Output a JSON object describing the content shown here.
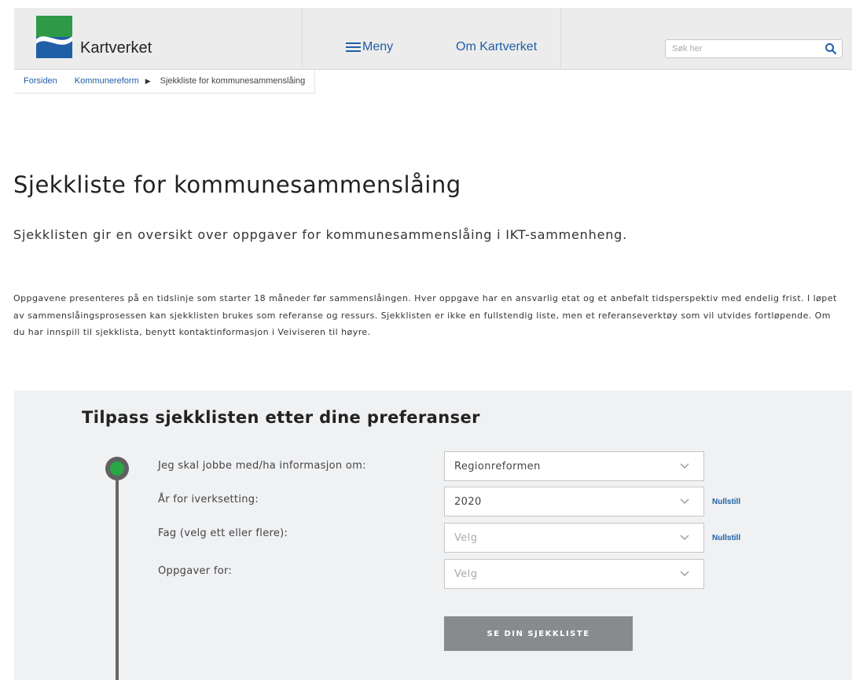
{
  "header": {
    "brand": "Kartverket",
    "menu_label": "Meny",
    "about_label": "Om Kartverket",
    "search_placeholder": "Søk her"
  },
  "breadcrumb": {
    "items": [
      "Forsiden",
      "Kommunereform"
    ],
    "current": "Sjekkliste for kommunesammenslåing"
  },
  "page": {
    "title": "Sjekkliste for kommunesammenslåing",
    "lead": "Sjekklisten gir en oversikt over oppgaver for kommunesammenslåing i IKT-sammenheng.",
    "body": "Oppgavene presenteres på en tidslinje som starter 18 måneder før sammenslåingen. Hver oppgave har en ansvarlig etat og et anbefalt tidsperspektiv med endelig frist. I løpet av sammenslåingsprosessen kan sjekklisten brukes som referanse og ressurs. Sjekklisten er ikke en fullstendig liste, men et referanseverktøy som vil utvides fortløpende. Om du har innspill til sjekklista, benytt kontaktinformasjon i Veiviseren til høyre."
  },
  "form": {
    "title": "Tilpass sjekklisten etter dine preferanser",
    "fields": [
      {
        "label": "Jeg skal jobbe med/ha informasjon om:",
        "value": "Regionreformen"
      },
      {
        "label": "År for iverksetting:",
        "value": "2020",
        "reset": "Nullstill"
      },
      {
        "label": "Fag (velg ett eller flere):",
        "value": "Velg",
        "reset": "Nullstill"
      },
      {
        "label": "Oppgaver for:",
        "value": "Velg"
      }
    ],
    "submit_label": "SE DIN SJEKKLISTE"
  },
  "colors": {
    "brand_blue": "#1f5fa8",
    "logo_green": "#2e9a47",
    "timeline_green": "#27a844",
    "button_gray": "#888b8e",
    "panel_bg": "#f0f1f3"
  }
}
